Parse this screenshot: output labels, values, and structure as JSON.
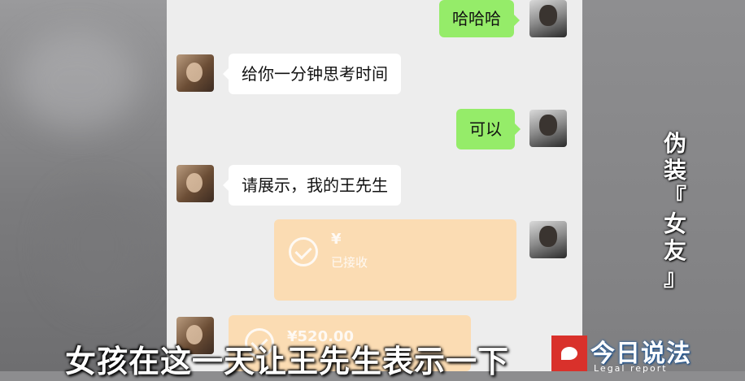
{
  "chat": {
    "messages": [
      {
        "side": "out",
        "text": "哈哈哈"
      },
      {
        "side": "in",
        "text": "给你一分钟思考时间"
      },
      {
        "side": "out",
        "text": "可以"
      },
      {
        "side": "in",
        "text": "请展示，我的王先生"
      }
    ],
    "transfer_out": {
      "amount": "¥",
      "status": "已接收"
    },
    "transfer_in": {
      "amount": "¥520.00"
    }
  },
  "overlay": {
    "side_title": [
      "伪",
      "装",
      "『",
      "女",
      "友",
      "』"
    ],
    "subtitle": "女孩在这一天让王先生表示一下",
    "logo_text": "今日说法",
    "logo_sub": "Legal report"
  },
  "colors": {
    "outgoing_bubble": "#95ec69",
    "incoming_bubble": "#ffffff",
    "transfer_card": "#fbdcb3",
    "chat_bg": "#ededed",
    "logo_red": "#d9312b"
  }
}
